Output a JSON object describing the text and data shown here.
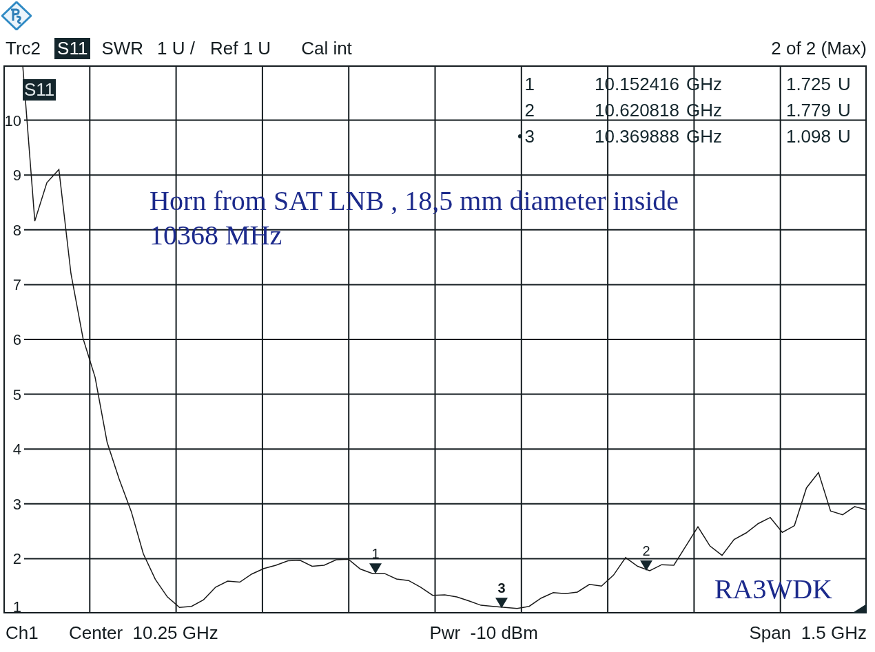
{
  "header": {
    "trace": "Trc2",
    "parameter": "S11",
    "format": "SWR",
    "scale": "1 U /",
    "reference": "Ref 1 U",
    "calibration": "Cal int",
    "page": "2 of 2 (Max)"
  },
  "marker_table": [
    {
      "number": "1",
      "frequency": "10.152416",
      "frequency_unit": "GHz",
      "value": "1.725",
      "value_unit": "U",
      "active": false
    },
    {
      "number": "2",
      "frequency": "10.620818",
      "frequency_unit": "GHz",
      "value": "1.779",
      "value_unit": "U",
      "active": false
    },
    {
      "number": "3",
      "frequency": "10.369888",
      "frequency_unit": "GHz",
      "value": "1.098",
      "value_unit": "U",
      "active": true
    }
  ],
  "trace_markers": [
    {
      "label": "1",
      "active": false
    },
    {
      "label": "2",
      "active": false
    },
    {
      "label": "3",
      "active": true
    }
  ],
  "notes": [
    "Horn from SAT LNB , 18,5 mm diameter inside",
    "10368 MHz"
  ],
  "signature": "RA3WDK",
  "chart_data": {
    "type": "line",
    "grid": true,
    "ylim": [
      1,
      11
    ],
    "yticks": [
      1,
      2,
      3,
      4,
      5,
      6,
      7,
      8,
      9,
      10
    ],
    "categories": [
      null,
      null,
      null,
      null,
      null,
      null,
      null,
      null,
      null,
      null,
      null,
      null,
      null,
      null,
      null,
      null,
      null,
      null,
      null,
      null,
      null,
      null,
      null,
      null,
      null,
      null,
      null,
      null,
      null,
      null,
      null,
      null,
      null,
      null,
      null,
      null,
      null,
      null,
      null,
      null,
      null,
      null,
      null,
      null,
      null,
      null,
      null,
      null,
      null,
      null,
      null,
      null,
      null,
      null,
      null,
      null,
      null,
      null,
      null,
      null,
      null,
      null,
      null,
      null,
      null,
      null,
      null,
      null,
      null,
      null,
      null
    ],
    "series": [
      {
        "name": "S11",
        "color": "#1a1a1a",
        "values": [
          11.0,
          8.16,
          8.86,
          9.1,
          7.2,
          6.02,
          5.31,
          4.12,
          3.45,
          2.86,
          2.09,
          1.62,
          1.3,
          1.11,
          1.13,
          1.25,
          1.48,
          1.59,
          1.57,
          1.72,
          1.82,
          1.88,
          1.96,
          1.97,
          1.86,
          1.88,
          1.98,
          1.99,
          1.81,
          1.73,
          1.73,
          1.63,
          1.6,
          1.48,
          1.33,
          1.34,
          1.3,
          1.23,
          1.15,
          1.13,
          1.11,
          1.09,
          1.13,
          1.28,
          1.38,
          1.36,
          1.39,
          1.53,
          1.5,
          1.7,
          2.02,
          1.86,
          1.78,
          1.89,
          1.88,
          2.23,
          2.58,
          2.23,
          2.06,
          2.35,
          2.47,
          2.64,
          2.75,
          2.48,
          2.6,
          3.29,
          3.57,
          2.87,
          2.8,
          2.95,
          2.89
        ]
      }
    ]
  },
  "footer": {
    "channel": "Ch1",
    "center": "Center  10.25 GHz",
    "power": "Pwr  -10 dBm",
    "span": "Span  1.5 GHz"
  }
}
